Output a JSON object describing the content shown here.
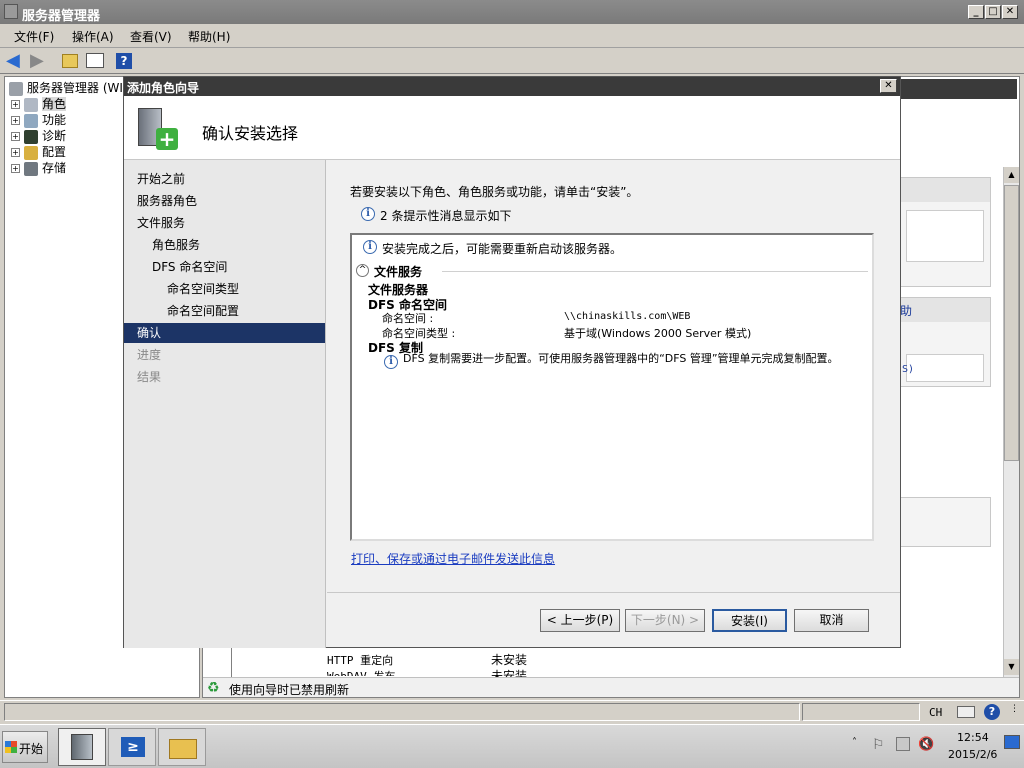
{
  "window": {
    "title": "服务器管理器"
  },
  "menu": [
    "文件(F)",
    "操作(A)",
    "查看(V)",
    "帮助(H)"
  ],
  "tree": {
    "root": "服务器管理器 (WI",
    "items": [
      "角色",
      "功能",
      "诊断",
      "配置",
      "存储"
    ]
  },
  "background": {
    "text_right1": "助",
    "text_right2": "S)",
    "rows": [
      {
        "name": "HTTP 重定向",
        "status": "未安装"
      },
      {
        "name": "WebDAV 发布",
        "status": "未安装"
      }
    ],
    "refresh_note": "使用向导时已禁用刷新"
  },
  "dialog": {
    "title": "添加角色向导",
    "heading": "确认安装选择",
    "nav": [
      {
        "label": "开始之前",
        "indent": 0
      },
      {
        "label": "服务器角色",
        "indent": 0
      },
      {
        "label": "文件服务",
        "indent": 0
      },
      {
        "label": "角色服务",
        "indent": 1
      },
      {
        "label": "DFS 命名空间",
        "indent": 1
      },
      {
        "label": "命名空间类型",
        "indent": 2
      },
      {
        "label": "命名空间配置",
        "indent": 2
      },
      {
        "label": "确认",
        "indent": 0,
        "selected": true
      },
      {
        "label": "进度",
        "indent": 0,
        "disabled": true
      },
      {
        "label": "结果",
        "indent": 0,
        "disabled": true
      }
    ],
    "intro": "若要安装以下角色、角色服务或功能，请单击“安装”。",
    "info_count": "2 条提示性消息显示如下",
    "detail": {
      "restart_note": "安装完成之后，可能需要重新启动该服务器。",
      "section": "文件服务",
      "group1": "文件服务器",
      "group2": "DFS 命名空间",
      "ns_label": "命名空间 :",
      "ns_value": "\\\\chinaskills.com\\WEB",
      "ns_type_label": "命名空间类型 :",
      "ns_type_value": "基于域(Windows 2000 Server 模式)",
      "group3": "DFS 复制",
      "dfs_note": "DFS 复制需要进一步配置。可使用服务器管理器中的“DFS 管理”管理单元完成复制配置。"
    },
    "link": "打印、保存或通过电子邮件发送此信息",
    "buttons": {
      "prev": "< 上一步(P)",
      "next": "下一步(N) >",
      "install": "安装(I)",
      "cancel": "取消"
    }
  },
  "taskbar": {
    "start": "开始",
    "lang": "CH",
    "time": "12:54",
    "date": "2015/2/6"
  }
}
